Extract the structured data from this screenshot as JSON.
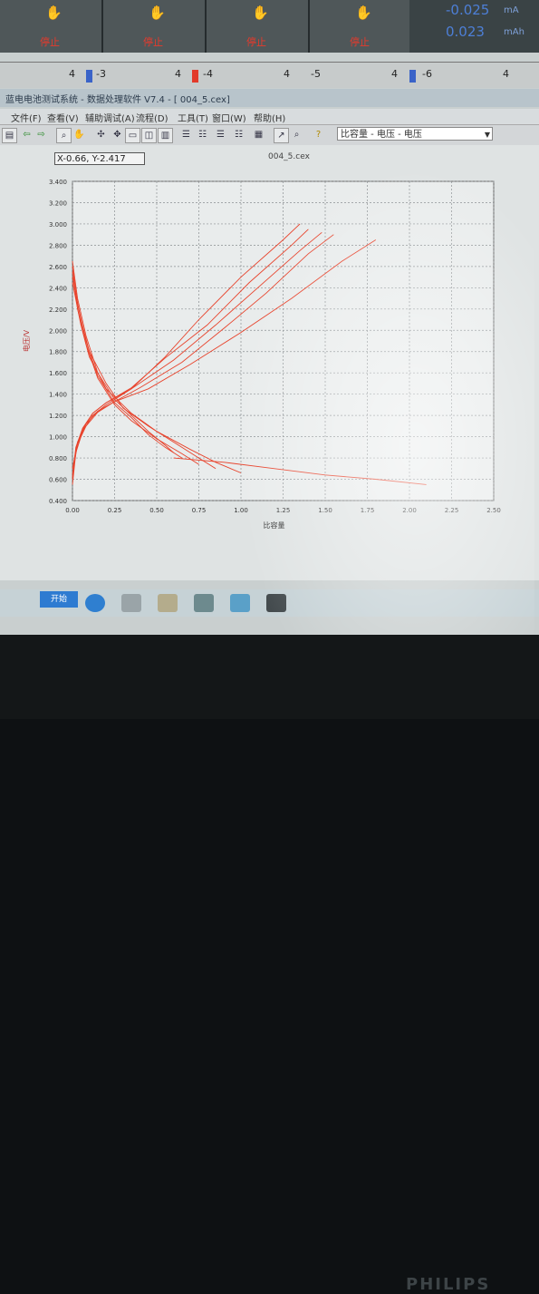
{
  "channels": [
    {
      "id": "ch1",
      "stop": "停止"
    },
    {
      "id": "ch2",
      "stop": "停止"
    },
    {
      "id": "ch3",
      "stop": "停止"
    },
    {
      "id": "ch4",
      "stop": "停止"
    }
  ],
  "readout": {
    "current": "-0.025",
    "current_unit": "mA",
    "capacity": "0.023",
    "capacity_unit": "mAh"
  },
  "channel_bar": {
    "items": [
      "4",
      "-3",
      "4",
      "-4",
      "4",
      "-5",
      "4",
      "-6",
      "4"
    ]
  },
  "window": {
    "title": "蓝电电池测试系统 - 数据处理软件 V7.4 - [ 004_5.cex]"
  },
  "menu": {
    "items": [
      "文件(F)",
      "查看(V)",
      "辅助调试(A)",
      "流程(D)",
      "工具(T)",
      "窗口(W)",
      "帮助(H)"
    ]
  },
  "toolbar": {
    "view_combo": "比容量 - 电压 - 电压"
  },
  "plot": {
    "coord_readout": "X-0.66, Y-2.417",
    "file_name": "004_5.cex",
    "ylabel": "电压/V",
    "xlabel": "比容量"
  },
  "chart_data": {
    "type": "line",
    "ylim": [
      0.4,
      3.4
    ],
    "xlim": [
      0.0,
      2.5
    ],
    "y_ticks": [
      "3.400",
      "3.200",
      "3.000",
      "2.800",
      "2.600",
      "2.400",
      "2.200",
      "2.000",
      "1.800",
      "1.600",
      "1.400",
      "1.200",
      "1.000",
      "0.800",
      "0.600",
      "0.400"
    ],
    "x_ticks": [
      "0.00",
      "0.25",
      "0.50",
      "0.75",
      "1.00",
      "1.25",
      "1.50",
      "1.75",
      "2.00",
      "2.25",
      "2.50"
    ],
    "series": [
      {
        "x": [
          0.0,
          0.03,
          0.08,
          0.15,
          0.25,
          0.35,
          0.45,
          0.55,
          0.6
        ],
        "y": [
          2.65,
          2.3,
          1.95,
          1.6,
          1.35,
          1.2,
          1.05,
          0.92,
          0.85
        ]
      },
      {
        "x": [
          0.0,
          0.03,
          0.08,
          0.15,
          0.25,
          0.35,
          0.45,
          0.55,
          0.65
        ],
        "y": [
          2.6,
          2.25,
          1.9,
          1.57,
          1.32,
          1.18,
          1.02,
          0.9,
          0.8
        ]
      },
      {
        "x": [
          0.0,
          0.03,
          0.08,
          0.15,
          0.25,
          0.35,
          0.5,
          0.65,
          0.75
        ],
        "y": [
          2.55,
          2.2,
          1.87,
          1.55,
          1.3,
          1.15,
          0.98,
          0.84,
          0.74
        ]
      },
      {
        "x": [
          0.0,
          0.05,
          0.1,
          0.2,
          0.3,
          0.45,
          0.6,
          0.75,
          0.85
        ],
        "y": [
          2.5,
          2.1,
          1.8,
          1.5,
          1.27,
          1.1,
          0.95,
          0.8,
          0.7
        ]
      },
      {
        "x": [
          0.0,
          0.05,
          0.1,
          0.2,
          0.35,
          0.5,
          0.7,
          0.85,
          1.0
        ],
        "y": [
          2.45,
          2.05,
          1.75,
          1.45,
          1.22,
          1.05,
          0.88,
          0.76,
          0.66
        ]
      },
      {
        "x": [
          0.0,
          0.02,
          0.06,
          0.12,
          0.2,
          0.35,
          0.55,
          0.75,
          1.0,
          1.25,
          1.35
        ],
        "y": [
          0.55,
          0.85,
          1.05,
          1.2,
          1.3,
          1.45,
          1.75,
          2.1,
          2.5,
          2.85,
          3.0
        ]
      },
      {
        "x": [
          0.0,
          0.02,
          0.06,
          0.12,
          0.2,
          0.35,
          0.55,
          0.8,
          1.05,
          1.3,
          1.4
        ],
        "y": [
          0.6,
          0.88,
          1.07,
          1.22,
          1.32,
          1.46,
          1.74,
          2.05,
          2.45,
          2.8,
          2.95
        ]
      },
      {
        "x": [
          0.0,
          0.02,
          0.06,
          0.12,
          0.2,
          0.35,
          0.6,
          0.85,
          1.1,
          1.35,
          1.48
        ],
        "y": [
          0.62,
          0.9,
          1.08,
          1.22,
          1.32,
          1.45,
          1.72,
          2.05,
          2.4,
          2.75,
          2.92
        ]
      },
      {
        "x": [
          0.0,
          0.03,
          0.08,
          0.15,
          0.25,
          0.4,
          0.65,
          0.9,
          1.15,
          1.4,
          1.55
        ],
        "y": [
          0.65,
          0.93,
          1.1,
          1.23,
          1.33,
          1.46,
          1.7,
          2.02,
          2.35,
          2.72,
          2.9
        ]
      },
      {
        "x": [
          0.0,
          0.03,
          0.08,
          0.15,
          0.25,
          0.45,
          0.7,
          1.0,
          1.3,
          1.6,
          1.8
        ],
        "y": [
          0.7,
          0.95,
          1.12,
          1.24,
          1.33,
          1.45,
          1.68,
          1.98,
          2.3,
          2.65,
          2.85
        ]
      },
      {
        "x": [
          0.6,
          0.9,
          1.2,
          1.5,
          1.8,
          2.1
        ],
        "y": [
          0.8,
          0.76,
          0.7,
          0.64,
          0.6,
          0.55
        ]
      }
    ]
  },
  "taskbar": {
    "start_label": "开始"
  },
  "monitor": {
    "brand": "PHILIPS"
  },
  "colors": {
    "curve": "#e8432c",
    "grid": "#8a8f92",
    "plot_bg": "#e9ecec",
    "readout": "#4d7fd6"
  }
}
